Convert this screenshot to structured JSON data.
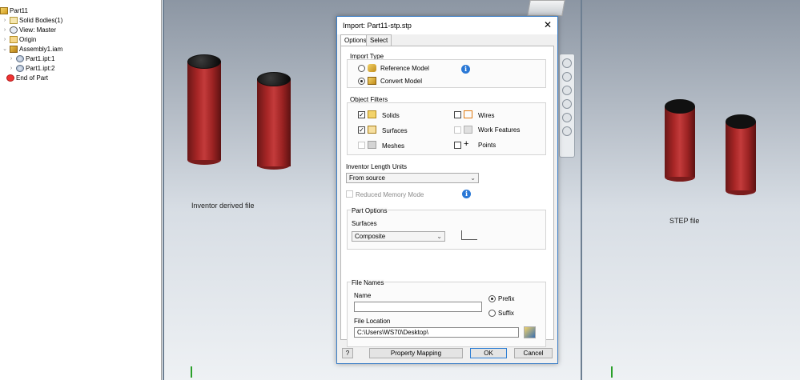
{
  "tree": {
    "items": [
      {
        "label": "Part11",
        "icon": "part-icon"
      },
      {
        "label": "Solid Bodies(1)",
        "icon": "solid-bodies-icon"
      },
      {
        "label": "View: Master",
        "icon": "view-icon"
      },
      {
        "label": "Origin",
        "icon": "folder-icon"
      },
      {
        "label": "Assembly1.iam",
        "icon": "assembly-icon"
      },
      {
        "label": "Part1.ipt:1",
        "icon": "occurrence-icon"
      },
      {
        "label": "Part1.ipt:2",
        "icon": "occurrence-icon"
      },
      {
        "label": "End of Part",
        "icon": "end-of-part-icon"
      }
    ]
  },
  "viewports": {
    "left_label": "Inventor derived file",
    "right_label": "STEP file"
  },
  "dialog": {
    "title": "Import:  Part11-stp.stp",
    "close": "✕",
    "tabs": [
      "Options",
      "Select"
    ],
    "import_type": {
      "heading": "Import Type",
      "reference_model": "Reference Model",
      "convert_model": "Convert Model",
      "selected": "Convert Model"
    },
    "object_filters": {
      "heading": "Object Filters",
      "solids": "Solids",
      "surfaces": "Surfaces",
      "meshes": "Meshes",
      "wires": "Wires",
      "work_features": "Work Features",
      "points": "Points"
    },
    "length_units": {
      "heading": "Inventor Length Units",
      "value": "From source"
    },
    "reduced_memory": "Reduced Memory Mode",
    "part_options": {
      "heading": "Part Options",
      "surfaces_label": "Surfaces",
      "surfaces_value": "Composite"
    },
    "file_names": {
      "heading": "File Names",
      "name_label": "Name",
      "name_value": "",
      "prefix": "Prefix",
      "suffix": "Suffix",
      "location_label": "File Location",
      "location_value": "C:\\Users\\WS70\\Desktop\\"
    },
    "buttons": {
      "property_mapping": "Property Mapping",
      "ok": "OK",
      "cancel": "Cancel",
      "help": "?"
    }
  },
  "colors": {
    "cylinder_red": "#b02a2a",
    "dialog_border": "#3d7fc7",
    "info_blue": "#2a78d6"
  }
}
